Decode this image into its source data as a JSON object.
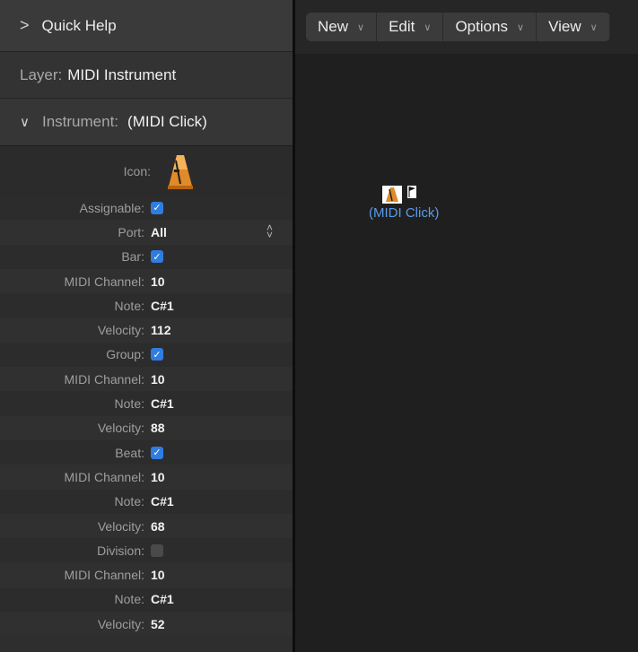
{
  "quick_help": {
    "label": "Quick Help"
  },
  "layer": {
    "label": "Layer:",
    "value": "MIDI Instrument"
  },
  "instrument": {
    "label": "Instrument:",
    "value": "(MIDI Click)"
  },
  "icon_row": {
    "label": "Icon:",
    "icon": "metronome-icon"
  },
  "properties": [
    {
      "label": "Assignable:",
      "type": "checkbox",
      "checked": true
    },
    {
      "label": "Port:",
      "type": "select",
      "value": "All"
    },
    {
      "label": "Bar:",
      "type": "checkbox",
      "checked": true
    },
    {
      "label": "MIDI Channel:",
      "type": "value",
      "value": "10"
    },
    {
      "label": "Note:",
      "type": "value",
      "value": "C#1"
    },
    {
      "label": "Velocity:",
      "type": "value",
      "value": "112"
    },
    {
      "label": "Group:",
      "type": "checkbox",
      "checked": true
    },
    {
      "label": "MIDI Channel:",
      "type": "value",
      "value": "10"
    },
    {
      "label": "Note:",
      "type": "value",
      "value": "C#1"
    },
    {
      "label": "Velocity:",
      "type": "value",
      "value": "88"
    },
    {
      "label": "Beat:",
      "type": "checkbox",
      "checked": true
    },
    {
      "label": "MIDI Channel:",
      "type": "value",
      "value": "10"
    },
    {
      "label": "Note:",
      "type": "value",
      "value": "C#1"
    },
    {
      "label": "Velocity:",
      "type": "value",
      "value": "68"
    },
    {
      "label": "Division:",
      "type": "checkbox",
      "checked": false
    },
    {
      "label": "MIDI Channel:",
      "type": "value",
      "value": "10"
    },
    {
      "label": "Note:",
      "type": "value",
      "value": "C#1"
    },
    {
      "label": "Velocity:",
      "type": "value",
      "value": "52"
    }
  ],
  "toolbar": {
    "new": "New",
    "edit": "Edit",
    "options": "Options",
    "view": "View"
  },
  "canvas_object": {
    "label": "(MIDI Click)"
  },
  "colors": {
    "accent": "#2f7de1",
    "link": "#5a9be8"
  }
}
